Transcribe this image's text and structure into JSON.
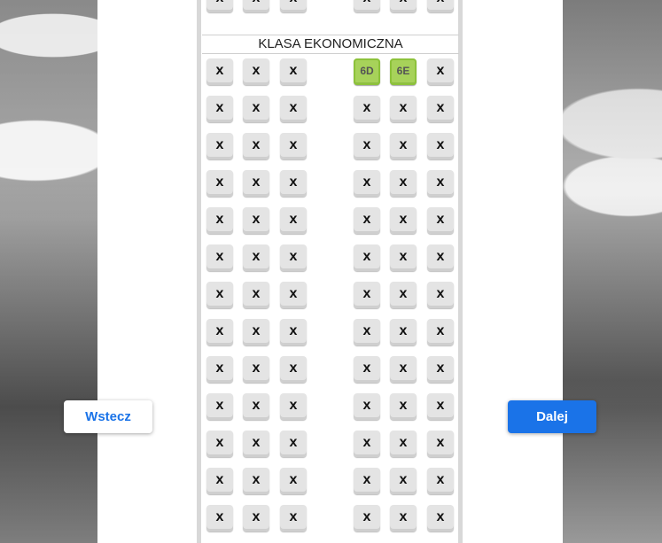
{
  "cabin": {
    "class_label": "KLASA EKONOMICZNA",
    "top_partial_row": [
      "x",
      "x",
      "x",
      "x",
      "x",
      "x"
    ],
    "rows": [
      [
        "x",
        "x",
        "x",
        "6D",
        "6E",
        "x"
      ],
      [
        "x",
        "x",
        "x",
        "x",
        "x",
        "x"
      ],
      [
        "x",
        "x",
        "x",
        "x",
        "x",
        "x"
      ],
      [
        "x",
        "x",
        "x",
        "x",
        "x",
        "x"
      ],
      [
        "x",
        "x",
        "x",
        "x",
        "x",
        "x"
      ],
      [
        "x",
        "x",
        "x",
        "x",
        "x",
        "x"
      ],
      [
        "x",
        "x",
        "x",
        "x",
        "x",
        "x"
      ],
      [
        "x",
        "x",
        "x",
        "x",
        "x",
        "x"
      ],
      [
        "x",
        "x",
        "x",
        "x",
        "x",
        "x"
      ],
      [
        "x",
        "x",
        "x",
        "x",
        "x",
        "x"
      ],
      [
        "x",
        "x",
        "x",
        "x",
        "x",
        "x"
      ],
      [
        "x",
        "x",
        "x",
        "x",
        "x",
        "x"
      ],
      [
        "x",
        "x",
        "x",
        "x",
        "x",
        "x"
      ]
    ],
    "available_seats": [
      "6D",
      "6E"
    ],
    "available_color": "#a7d25a",
    "occupied_color": "#e4e4e4"
  },
  "navigation": {
    "back_label": "Wstecz",
    "next_label": "Dalej",
    "primary_color": "#1a73e8"
  }
}
